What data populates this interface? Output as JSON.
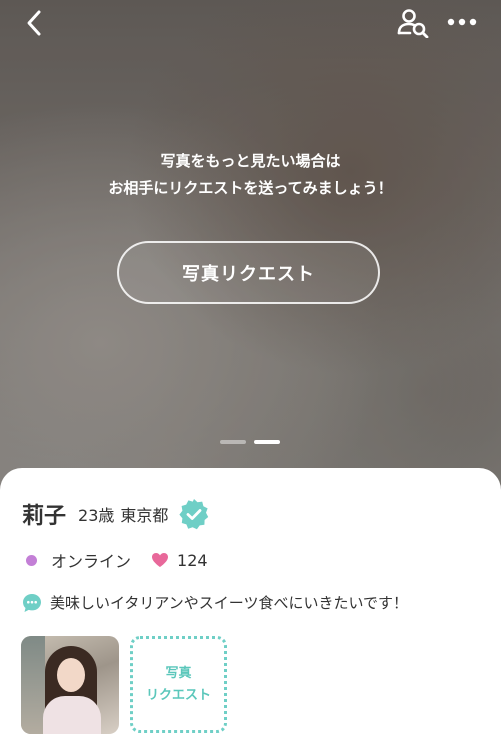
{
  "hero": {
    "message_line1": "写真をもっと見たい場合は",
    "message_line2": "お相手にリクエストを送ってみましょう！",
    "request_button_label": "写真リクエスト",
    "page_count": 2,
    "active_page": 1
  },
  "icons": {
    "back": "chevron-left-icon",
    "user_search": "user-search-icon",
    "more": "more-horizontal-icon",
    "verified": "verified-badge-icon",
    "online": "online-dot-icon",
    "heart": "heart-icon",
    "comment": "speech-bubble-icon"
  },
  "profile": {
    "name": "莉子",
    "age": "23歳",
    "area": "東京都",
    "status": "オンライン",
    "likes": "124",
    "comment": "美味しいイタリアンやスイーツ食べにいきたいです！",
    "request_tile_line1": "写真",
    "request_tile_line2": "リクエスト"
  },
  "colors": {
    "accent_teal": "#6fcfc6",
    "online": "#c37fd6",
    "heart": "#e8689a"
  }
}
